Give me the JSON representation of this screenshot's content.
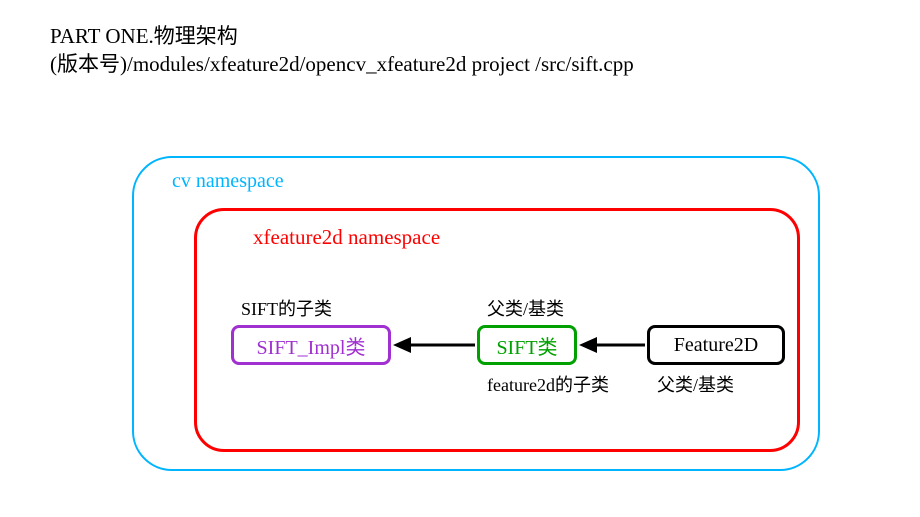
{
  "header": {
    "line1": "PART ONE.物理架构",
    "line2": "(版本号)/modules/xfeature2d/opencv_xfeature2d project /src/sift.cpp"
  },
  "outer_namespace": {
    "label": "cv namespace",
    "color": "#00b5ff"
  },
  "inner_namespace": {
    "label": "xfeature2d namespace",
    "color": "#ff0000"
  },
  "classes": {
    "sift_impl": {
      "name": "SIFT_Impl类",
      "top_note": "SIFT的子类",
      "color": "#a030d0"
    },
    "sift": {
      "name": "SIFT类",
      "top_note": "父类/基类",
      "bottom_note": "feature2d的子类",
      "color": "#00a000"
    },
    "feature2d": {
      "name": "Feature2D",
      "bottom_note": "父类/基类",
      "color": "#000000"
    }
  },
  "arrows": [
    {
      "from": "sift",
      "to": "sift_impl",
      "direction": "left"
    },
    {
      "from": "feature2d",
      "to": "sift",
      "direction": "left"
    }
  ]
}
